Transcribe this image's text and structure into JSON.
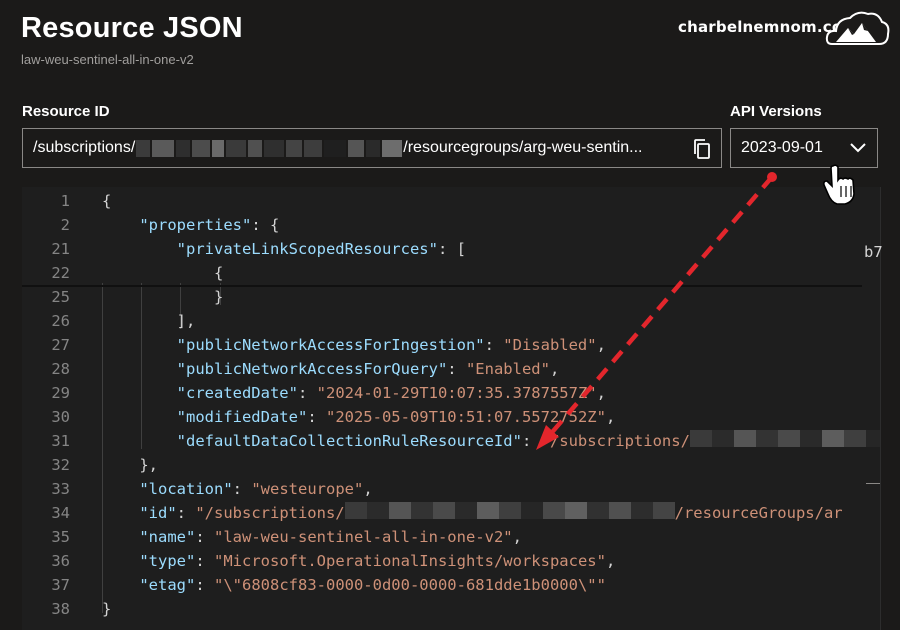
{
  "header": {
    "title": "Resource JSON",
    "subtitle": "law-weu-sentinel-all-in-one-v2",
    "watermark": "charbelnemnom.com"
  },
  "resource_id": {
    "label": "Resource ID",
    "prefix": "/subscriptions/",
    "suffix": "/resourcegroups/arg-weu-sentin...",
    "copy_icon": "copy-icon"
  },
  "api_versions": {
    "label": "API Versions",
    "selected": "2023-09-01",
    "icon": "chevron-down-icon"
  },
  "editor": {
    "right_fragment": "b7",
    "lines": [
      {
        "n": "1",
        "parts": [
          {
            "t": "{",
            "c": "p"
          }
        ]
      },
      {
        "n": "2",
        "parts": [
          {
            "t": "    ",
            "c": "p"
          },
          {
            "t": "\"properties\"",
            "c": "k"
          },
          {
            "t": ": {",
            "c": "p"
          }
        ]
      },
      {
        "n": "21",
        "parts": [
          {
            "t": "        ",
            "c": "p"
          },
          {
            "t": "\"privateLinkScopedResources\"",
            "c": "k"
          },
          {
            "t": ": [",
            "c": "p"
          }
        ]
      },
      {
        "n": "22",
        "parts": [
          {
            "t": "            {",
            "c": "p"
          }
        ]
      },
      {
        "n": "25",
        "parts": [
          {
            "t": "            }",
            "c": "p"
          }
        ]
      },
      {
        "n": "26",
        "parts": [
          {
            "t": "        ],",
            "c": "p"
          }
        ]
      },
      {
        "n": "27",
        "parts": [
          {
            "t": "        ",
            "c": "p"
          },
          {
            "t": "\"publicNetworkAccessForIngestion\"",
            "c": "k"
          },
          {
            "t": ": ",
            "c": "p"
          },
          {
            "t": "\"Disabled\"",
            "c": "s"
          },
          {
            "t": ",",
            "c": "p"
          }
        ]
      },
      {
        "n": "28",
        "parts": [
          {
            "t": "        ",
            "c": "p"
          },
          {
            "t": "\"publicNetworkAccessForQuery\"",
            "c": "k"
          },
          {
            "t": ": ",
            "c": "p"
          },
          {
            "t": "\"Enabled\"",
            "c": "s"
          },
          {
            "t": ",",
            "c": "p"
          }
        ]
      },
      {
        "n": "29",
        "parts": [
          {
            "t": "        ",
            "c": "p"
          },
          {
            "t": "\"createdDate\"",
            "c": "k"
          },
          {
            "t": ": ",
            "c": "p"
          },
          {
            "t": "\"2024-01-29T10:07:35.3787557Z\"",
            "c": "s"
          },
          {
            "t": ",",
            "c": "p"
          }
        ]
      },
      {
        "n": "30",
        "parts": [
          {
            "t": "        ",
            "c": "p"
          },
          {
            "t": "\"modifiedDate\"",
            "c": "k"
          },
          {
            "t": ": ",
            "c": "p"
          },
          {
            "t": "\"2025-05-09T10:51:07.5572752Z\"",
            "c": "s"
          },
          {
            "t": ",",
            "c": "p"
          }
        ]
      },
      {
        "n": "31",
        "parts": [
          {
            "t": "        ",
            "c": "p"
          },
          {
            "t": "\"defaultDataCollectionRuleResourceId\"",
            "c": "k"
          },
          {
            "t": ": ",
            "c": "p"
          },
          {
            "t": "\"/subscriptions/",
            "c": "s"
          }
        ]
      },
      {
        "n": "32",
        "parts": [
          {
            "t": "    },",
            "c": "p"
          }
        ]
      },
      {
        "n": "33",
        "parts": [
          {
            "t": "    ",
            "c": "p"
          },
          {
            "t": "\"location\"",
            "c": "k"
          },
          {
            "t": ": ",
            "c": "p"
          },
          {
            "t": "\"westeurope\"",
            "c": "s"
          },
          {
            "t": ",",
            "c": "p"
          }
        ]
      },
      {
        "n": "34",
        "parts": [
          {
            "t": "    ",
            "c": "p"
          },
          {
            "t": "\"id\"",
            "c": "k"
          },
          {
            "t": ": ",
            "c": "p"
          },
          {
            "t": "\"/subscriptions/",
            "c": "s"
          }
        ]
      },
      {
        "n": "35",
        "parts": [
          {
            "t": "    ",
            "c": "p"
          },
          {
            "t": "\"name\"",
            "c": "k"
          },
          {
            "t": ": ",
            "c": "p"
          },
          {
            "t": "\"law-weu-sentinel-all-in-one-v2\"",
            "c": "s"
          },
          {
            "t": ",",
            "c": "p"
          }
        ]
      },
      {
        "n": "36",
        "parts": [
          {
            "t": "    ",
            "c": "p"
          },
          {
            "t": "\"type\"",
            "c": "k"
          },
          {
            "t": ": ",
            "c": "p"
          },
          {
            "t": "\"Microsoft.OperationalInsights/workspaces\"",
            "c": "s"
          },
          {
            "t": ",",
            "c": "p"
          }
        ]
      },
      {
        "n": "37",
        "parts": [
          {
            "t": "    ",
            "c": "p"
          },
          {
            "t": "\"etag\"",
            "c": "k"
          },
          {
            "t": ": ",
            "c": "p"
          },
          {
            "t": "\"\\\"6808cf83-0000-0d00-0000-681dde1b0000\\\"\"",
            "c": "s"
          }
        ]
      },
      {
        "n": "38",
        "parts": [
          {
            "t": "}",
            "c": "p"
          }
        ]
      }
    ],
    "line34_tail": "/resourceGroups/ar"
  },
  "colors": {
    "background": "#1b1a19",
    "editor_bg": "#1e1e1e",
    "key": "#9cdcfe",
    "string": "#ce9178",
    "punct": "#d4d4d4",
    "line_number": "#858585",
    "arrow": "#e3262c"
  }
}
